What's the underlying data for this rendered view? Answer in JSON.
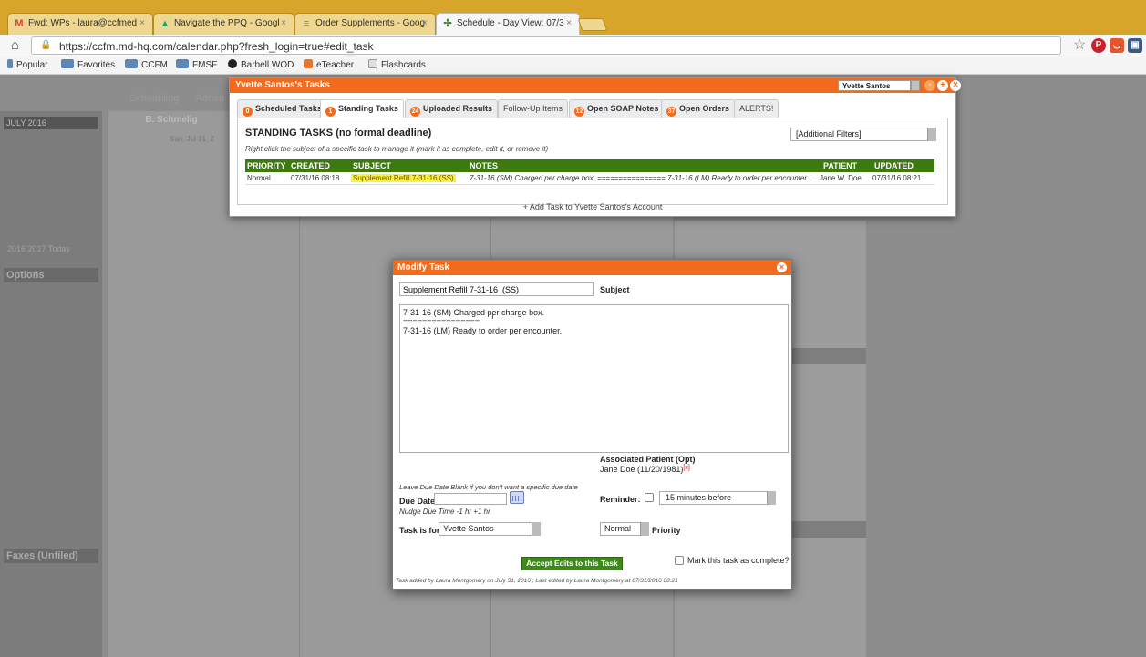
{
  "browser": {
    "tabs": [
      {
        "label": "Fwd: WPs - laura@ccfmed",
        "icon": "gmail-icon",
        "icon_text": "M",
        "icon_color": "#d44638"
      },
      {
        "label": "Navigate the PPQ - Googl",
        "icon": "drive-icon",
        "icon_text": "▲",
        "icon_color": "#1fa463"
      },
      {
        "label": "Order Supplements - Goog",
        "icon": "docs-icon",
        "icon_text": "≡",
        "icon_color": "#4a8af4"
      },
      {
        "label": "Schedule - Day View: 07/3",
        "icon": "app-icon",
        "icon_text": "✢",
        "icon_color": "#3a7d2c"
      }
    ],
    "url": "https://ccfm.md-hq.com/calendar.php?fresh_login=true#edit_task",
    "bookmarks": [
      "Popular",
      "Favorites",
      "CCFM",
      "FMSF",
      "Barbell WOD",
      "eTeacher",
      "Flashcards"
    ]
  },
  "background_page": {
    "nav": "Scheduling",
    "nav2": "Admin",
    "calendar_header": "JULY 2016",
    "schedule_header": "B. Schmelig",
    "schedule_sub": "Sun, Jul 31, 2",
    "sections": [
      "Options",
      "Faxes (Unfiled)"
    ],
    "today_row": "2016  2017  Today"
  },
  "tasks_panel": {
    "title": "Yvette Santos's Tasks",
    "user_select": "Yvette Santos",
    "tabs": [
      {
        "label": "Scheduled Tasks",
        "badge": "0"
      },
      {
        "label": "Standing Tasks",
        "badge": "1"
      },
      {
        "label": "Uploaded Results",
        "badge": "24"
      },
      {
        "label": "Follow-Up Items",
        "badge": ""
      },
      {
        "label": "Open SOAP Notes",
        "badge": "12"
      },
      {
        "label": "Open Orders",
        "badge": "37"
      },
      {
        "label": "ALERTS!",
        "badge": ""
      }
    ],
    "heading": "STANDING TASKS (no formal deadline)",
    "hint": "Right click the subject of a specific task to manage it (mark it as complete, edit it, or remove it)",
    "filter": "[Additional Filters]",
    "columns": [
      "PRIORITY",
      "CREATED",
      "SUBJECT",
      "NOTES",
      "PATIENT",
      "UPDATED"
    ],
    "rows": [
      {
        "priority": "Normal",
        "created": "07/31/16 08:18",
        "subject": "Supplement Refill 7-31-16 (SS)",
        "notes": "7-31-16 (SM) Charged per charge box. ================ 7-31-16 (LM) Ready to order per encounter...",
        "patient": "Jane W. Doe",
        "updated": "07/31/16 08:21"
      }
    ],
    "add_task": "+ Add Task to Yvette Santos's Account"
  },
  "modify_task": {
    "title": "Modify Task",
    "subject_value": "Supplement Refill 7-31-16  (SS)",
    "subject_label": "Subject",
    "notes_value": "7-31-16 (SM) Charged per charge box.\n================\n7-31-16 (LM) Ready to order per encounter.",
    "assoc_label": "Associated Patient (Opt)",
    "assoc_value": "Jane Doe (11/20/1981)",
    "assoc_remove": "[x]",
    "due_hint": "Leave Due Date Blank if you don't want a specific due date",
    "due_label": "Due Date",
    "due_value": "",
    "nudge": "Nudge Due Time -1 hr  +1 hr",
    "reminder_label": "Reminder:",
    "reminder_value": "15 minutes before",
    "task_for_label": "Task is for",
    "task_for_value": "Yvette Santos",
    "priority_value": "Normal",
    "priority_label": "Priority",
    "accept_label": "Accept Edits to this Task",
    "complete_label": "Mark this task as complete?",
    "footer": "Task added by Laura Montgomery on July 31, 2016 ; Last edited by Laura Montgomery at 07/31/2016 08:21"
  },
  "colors": {
    "accent": "#f26b1d",
    "grid_header": "#3c7a10",
    "highlight": "#f6f33a"
  }
}
